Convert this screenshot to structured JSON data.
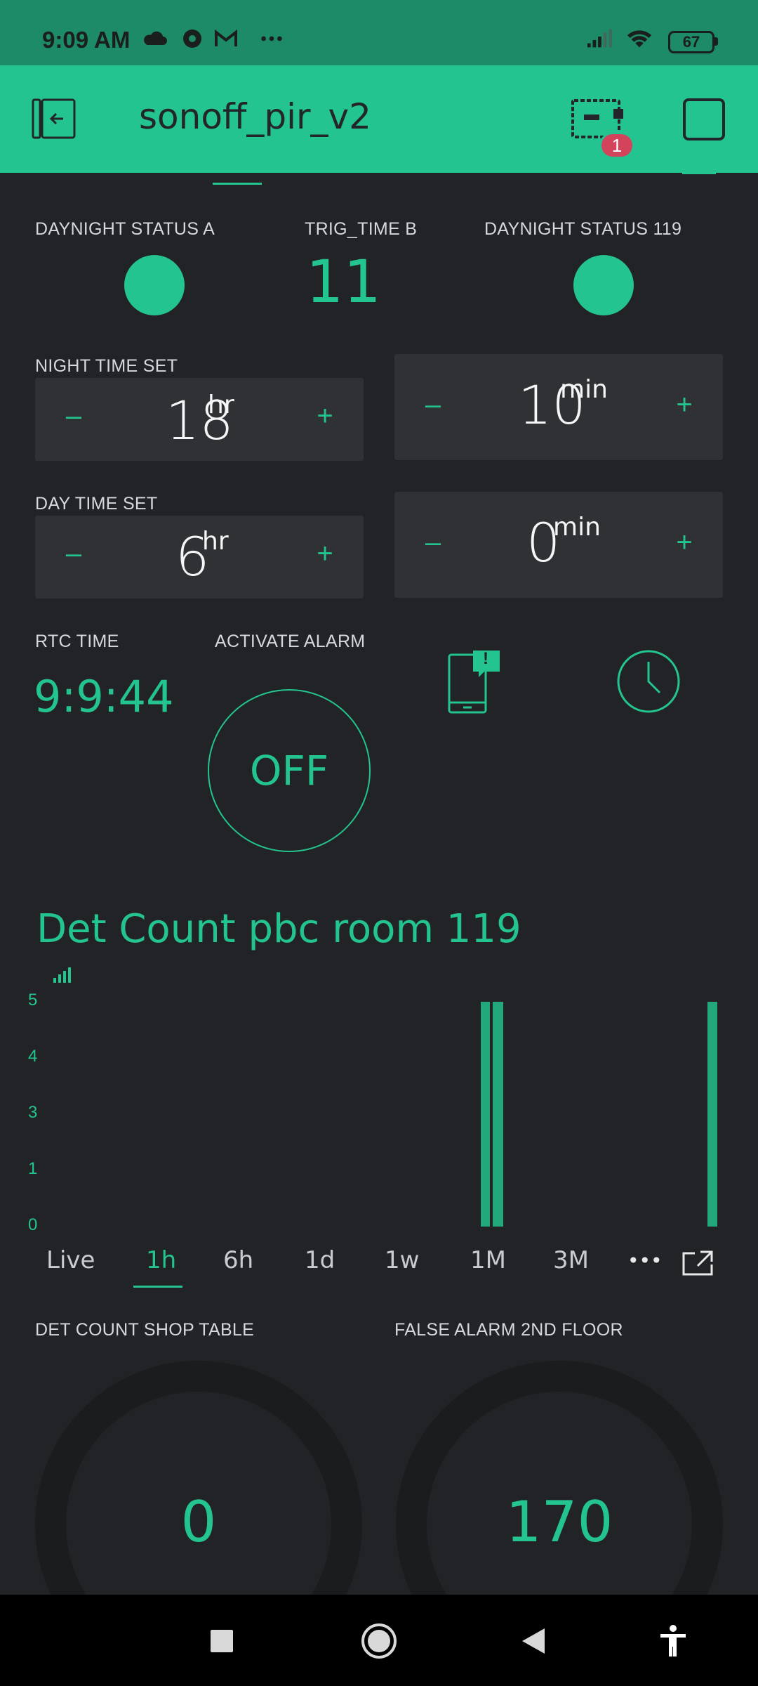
{
  "status_bar": {
    "time": "9:09 AM",
    "battery": "67",
    "icons": [
      "cloud-icon",
      "chrome-icon",
      "gmail-icon",
      "more-dots-icon",
      "signal-icon",
      "wifi-icon",
      "battery-icon"
    ]
  },
  "app_bar": {
    "title": "sonoff_pir_v2",
    "notification_count": "1",
    "icons": [
      "exit-icon",
      "device-icon",
      "stop-icon"
    ],
    "background": "#23c48f"
  },
  "widgets": {
    "led_a_label": "DAYNIGHT STATUS A",
    "trig_label": "TRIG_TIME B",
    "trig_value": "11",
    "led_119_label": "DAYNIGHT STATUS 119",
    "night_label": "NIGHT TIME SET",
    "night_hr": "18",
    "night_min": "10",
    "day_label": "DAY TIME SET",
    "day_hr": "6",
    "day_min": "0",
    "hr_unit": "hr",
    "min_unit": "min",
    "minus": "–",
    "plus": "+",
    "rtc_label": "RTC TIME",
    "rtc_value": "9:9:44",
    "alarm_label": "ACTIVATE ALARM",
    "alarm_state": "OFF",
    "notification_icon_badge": "!"
  },
  "chart": {
    "title": "Det Count pbc room 119",
    "periods": [
      "Live",
      "1h",
      "6h",
      "1d",
      "1w",
      "1M",
      "3M"
    ],
    "active_period": "1h",
    "more_label": "•••",
    "accent": "#23c48f"
  },
  "chart_data": {
    "type": "bar",
    "yticks": [
      "5",
      "4",
      "3",
      "1",
      "0"
    ],
    "ylim": [
      0,
      5
    ],
    "series": [
      {
        "values": [
          5,
          5,
          5
        ]
      }
    ],
    "grid": false
  },
  "gauges": {
    "left_label": "DET COUNT SHOP TABLE",
    "left_value": "0",
    "right_label": "FALSE ALARM 2ND FLOOR",
    "right_value": "170"
  },
  "nav_bar": {
    "icons": [
      "square-recents-icon",
      "home-circle-icon",
      "back-triangle-icon",
      "accessibility-icon"
    ]
  }
}
